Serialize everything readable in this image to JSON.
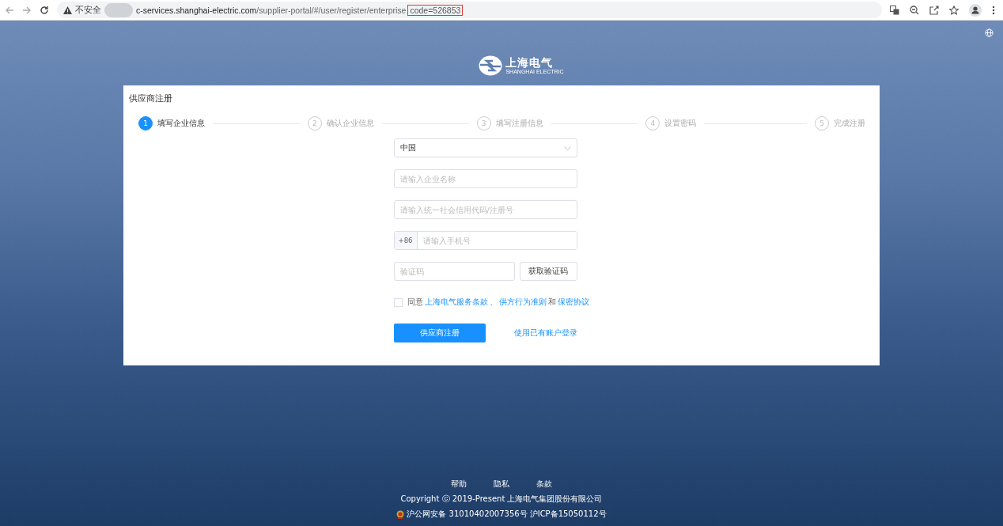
{
  "browser": {
    "security_label": "不安全",
    "url_host": "c-services.shanghai-electric.com",
    "url_path": "/supplier-portal/#/user/register/enterprise",
    "url_highlight": "code=526853"
  },
  "logo": {
    "name": "上海电气",
    "subtitle": "SHANGHAI ELECTRIC"
  },
  "card": {
    "title": "供应商注册"
  },
  "steps": [
    {
      "number": "1",
      "label": "填写企业信息",
      "selected": true
    },
    {
      "number": "2",
      "label": "确认企业信息",
      "selected": false
    },
    {
      "number": "3",
      "label": "填写注册信息",
      "selected": false
    },
    {
      "number": "4",
      "label": "设置密码",
      "selected": false
    },
    {
      "number": "5",
      "label": "完成注册",
      "selected": false
    }
  ],
  "form": {
    "country": "中国",
    "company_placeholder": "请输入企业名称",
    "credit_code_placeholder": "请输入统一社会信用代码/注册号",
    "phone_prefix": "+86",
    "phone_placeholder": "请输入手机号",
    "code_placeholder": "验证码",
    "get_code_button": "获取验证码",
    "agreement": {
      "checked": false,
      "prefix": "同意",
      "links": [
        "上海电气服务条款",
        "供方行为准则",
        "保密协议"
      ],
      "separator": "、",
      "conjunction": "和"
    },
    "submit_button": "供应商注册",
    "login_link": "使用已有账户登录"
  },
  "footer": {
    "links": [
      "帮助",
      "隐私",
      "条款"
    ],
    "copyright": "Copyright ⓒ 2019-Present 上海电气集团股份有限公司",
    "police_record": "沪公网安备 31010402007356号",
    "icp_record": "沪ICP备15050112号"
  }
}
